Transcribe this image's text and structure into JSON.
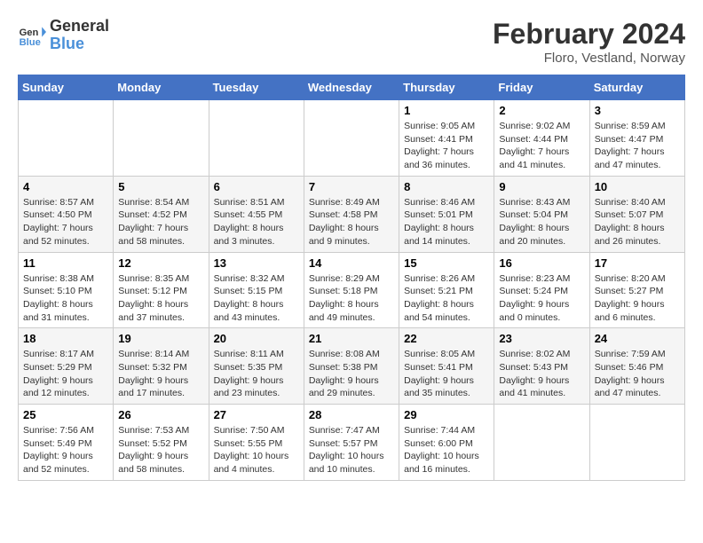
{
  "header": {
    "logo_line1": "General",
    "logo_line2": "Blue",
    "title": "February 2024",
    "subtitle": "Floro, Vestland, Norway"
  },
  "weekdays": [
    "Sunday",
    "Monday",
    "Tuesday",
    "Wednesday",
    "Thursday",
    "Friday",
    "Saturday"
  ],
  "weeks": [
    [
      {
        "day": "",
        "info": ""
      },
      {
        "day": "",
        "info": ""
      },
      {
        "day": "",
        "info": ""
      },
      {
        "day": "",
        "info": ""
      },
      {
        "day": "1",
        "info": "Sunrise: 9:05 AM\nSunset: 4:41 PM\nDaylight: 7 hours\nand 36 minutes."
      },
      {
        "day": "2",
        "info": "Sunrise: 9:02 AM\nSunset: 4:44 PM\nDaylight: 7 hours\nand 41 minutes."
      },
      {
        "day": "3",
        "info": "Sunrise: 8:59 AM\nSunset: 4:47 PM\nDaylight: 7 hours\nand 47 minutes."
      }
    ],
    [
      {
        "day": "4",
        "info": "Sunrise: 8:57 AM\nSunset: 4:50 PM\nDaylight: 7 hours\nand 52 minutes."
      },
      {
        "day": "5",
        "info": "Sunrise: 8:54 AM\nSunset: 4:52 PM\nDaylight: 7 hours\nand 58 minutes."
      },
      {
        "day": "6",
        "info": "Sunrise: 8:51 AM\nSunset: 4:55 PM\nDaylight: 8 hours\nand 3 minutes."
      },
      {
        "day": "7",
        "info": "Sunrise: 8:49 AM\nSunset: 4:58 PM\nDaylight: 8 hours\nand 9 minutes."
      },
      {
        "day": "8",
        "info": "Sunrise: 8:46 AM\nSunset: 5:01 PM\nDaylight: 8 hours\nand 14 minutes."
      },
      {
        "day": "9",
        "info": "Sunrise: 8:43 AM\nSunset: 5:04 PM\nDaylight: 8 hours\nand 20 minutes."
      },
      {
        "day": "10",
        "info": "Sunrise: 8:40 AM\nSunset: 5:07 PM\nDaylight: 8 hours\nand 26 minutes."
      }
    ],
    [
      {
        "day": "11",
        "info": "Sunrise: 8:38 AM\nSunset: 5:10 PM\nDaylight: 8 hours\nand 31 minutes."
      },
      {
        "day": "12",
        "info": "Sunrise: 8:35 AM\nSunset: 5:12 PM\nDaylight: 8 hours\nand 37 minutes."
      },
      {
        "day": "13",
        "info": "Sunrise: 8:32 AM\nSunset: 5:15 PM\nDaylight: 8 hours\nand 43 minutes."
      },
      {
        "day": "14",
        "info": "Sunrise: 8:29 AM\nSunset: 5:18 PM\nDaylight: 8 hours\nand 49 minutes."
      },
      {
        "day": "15",
        "info": "Sunrise: 8:26 AM\nSunset: 5:21 PM\nDaylight: 8 hours\nand 54 minutes."
      },
      {
        "day": "16",
        "info": "Sunrise: 8:23 AM\nSunset: 5:24 PM\nDaylight: 9 hours\nand 0 minutes."
      },
      {
        "day": "17",
        "info": "Sunrise: 8:20 AM\nSunset: 5:27 PM\nDaylight: 9 hours\nand 6 minutes."
      }
    ],
    [
      {
        "day": "18",
        "info": "Sunrise: 8:17 AM\nSunset: 5:29 PM\nDaylight: 9 hours\nand 12 minutes."
      },
      {
        "day": "19",
        "info": "Sunrise: 8:14 AM\nSunset: 5:32 PM\nDaylight: 9 hours\nand 17 minutes."
      },
      {
        "day": "20",
        "info": "Sunrise: 8:11 AM\nSunset: 5:35 PM\nDaylight: 9 hours\nand 23 minutes."
      },
      {
        "day": "21",
        "info": "Sunrise: 8:08 AM\nSunset: 5:38 PM\nDaylight: 9 hours\nand 29 minutes."
      },
      {
        "day": "22",
        "info": "Sunrise: 8:05 AM\nSunset: 5:41 PM\nDaylight: 9 hours\nand 35 minutes."
      },
      {
        "day": "23",
        "info": "Sunrise: 8:02 AM\nSunset: 5:43 PM\nDaylight: 9 hours\nand 41 minutes."
      },
      {
        "day": "24",
        "info": "Sunrise: 7:59 AM\nSunset: 5:46 PM\nDaylight: 9 hours\nand 47 minutes."
      }
    ],
    [
      {
        "day": "25",
        "info": "Sunrise: 7:56 AM\nSunset: 5:49 PM\nDaylight: 9 hours\nand 52 minutes."
      },
      {
        "day": "26",
        "info": "Sunrise: 7:53 AM\nSunset: 5:52 PM\nDaylight: 9 hours\nand 58 minutes."
      },
      {
        "day": "27",
        "info": "Sunrise: 7:50 AM\nSunset: 5:55 PM\nDaylight: 10 hours\nand 4 minutes."
      },
      {
        "day": "28",
        "info": "Sunrise: 7:47 AM\nSunset: 5:57 PM\nDaylight: 10 hours\nand 10 minutes."
      },
      {
        "day": "29",
        "info": "Sunrise: 7:44 AM\nSunset: 6:00 PM\nDaylight: 10 hours\nand 16 minutes."
      },
      {
        "day": "",
        "info": ""
      },
      {
        "day": "",
        "info": ""
      }
    ]
  ]
}
